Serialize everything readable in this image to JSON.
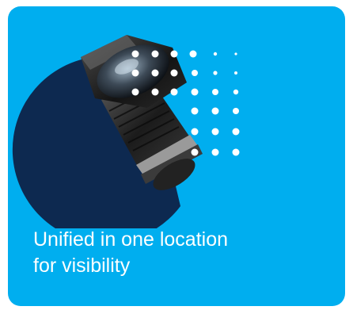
{
  "card": {
    "background_color": "#00aeef",
    "shape_color": "#0d2950",
    "dot_color": "#ffffff",
    "illustration_icon": "camera-lens-icon",
    "caption": {
      "line1": "Unified in one location",
      "line2": "for visibility"
    }
  }
}
